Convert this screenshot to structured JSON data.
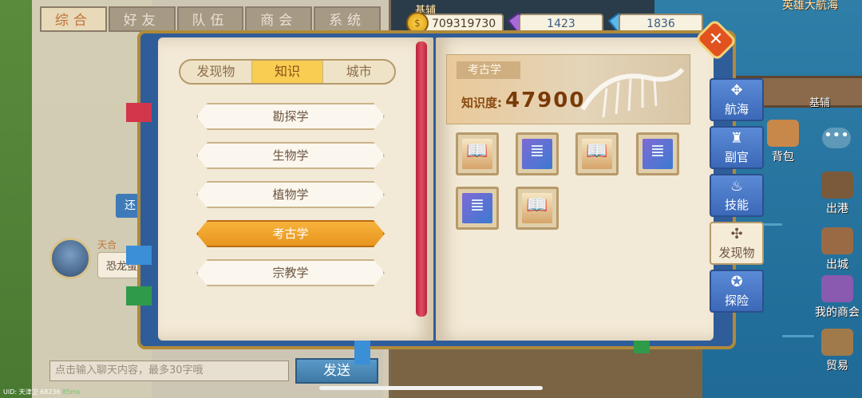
{
  "world": {
    "top_banner": "英雄大航海",
    "shop_label": "基辅",
    "dock_label": "基辅"
  },
  "chat": {
    "tabs": [
      {
        "label": "综合",
        "active": true
      },
      {
        "label": "好友",
        "active": false
      },
      {
        "label": "队伍",
        "active": false
      },
      {
        "label": "商会",
        "active": false
      },
      {
        "label": "系统",
        "active": false
      }
    ],
    "hint_button": "还",
    "message_sender": "天合",
    "message_text": "恐龙蛋",
    "input_placeholder": "点击输入聊天内容，最多30字哦",
    "send_label": "发送"
  },
  "status_bar": {
    "uid": "UID: 天津卫 68236",
    "ping": "85ms"
  },
  "resources": {
    "gold": "709319730",
    "gem_purple": "1423",
    "gem_blue": "1836"
  },
  "book": {
    "sub_tabs": [
      {
        "label": "发现物",
        "active": false
      },
      {
        "label": "知识",
        "active": true
      },
      {
        "label": "城市",
        "active": false
      }
    ],
    "topics": [
      {
        "label": "勘探学",
        "selected": false
      },
      {
        "label": "生物学",
        "selected": false
      },
      {
        "label": "植物学",
        "selected": false
      },
      {
        "label": "考古学",
        "selected": true
      },
      {
        "label": "宗教学",
        "selected": false
      }
    ],
    "detail": {
      "title": "考古学",
      "knowledge_label": "知识度:",
      "knowledge_value": "47900"
    },
    "items": [
      {
        "kind": "book",
        "icon": "open-book-icon"
      },
      {
        "kind": "scroll",
        "icon": "scroll-icon"
      },
      {
        "kind": "book",
        "icon": "open-book-icon"
      },
      {
        "kind": "scroll",
        "icon": "scroll-icon"
      },
      {
        "kind": "scroll",
        "icon": "scroll-icon"
      },
      {
        "kind": "book",
        "icon": "open-book-icon"
      }
    ]
  },
  "side_menu": [
    {
      "label": "航海",
      "icon": "compass-icon",
      "active": false
    },
    {
      "label": "副官",
      "icon": "officer-icon",
      "active": false
    },
    {
      "label": "技能",
      "icon": "flame-icon",
      "active": false
    },
    {
      "label": "发现物",
      "icon": "discovery-icon",
      "active": true
    },
    {
      "label": "探险",
      "icon": "explore-icon",
      "active": false
    }
  ],
  "map_menu": {
    "bag": "背包",
    "port_out": "出港",
    "city_out": "出城",
    "guild": "我的商会",
    "trade": "贸易"
  },
  "colors": {
    "book_blue": "#2f5d9a",
    "parchment": "#f2e9d6",
    "selected_orange": "#e8951e",
    "active_tab_yellow": "#f7cd52"
  }
}
